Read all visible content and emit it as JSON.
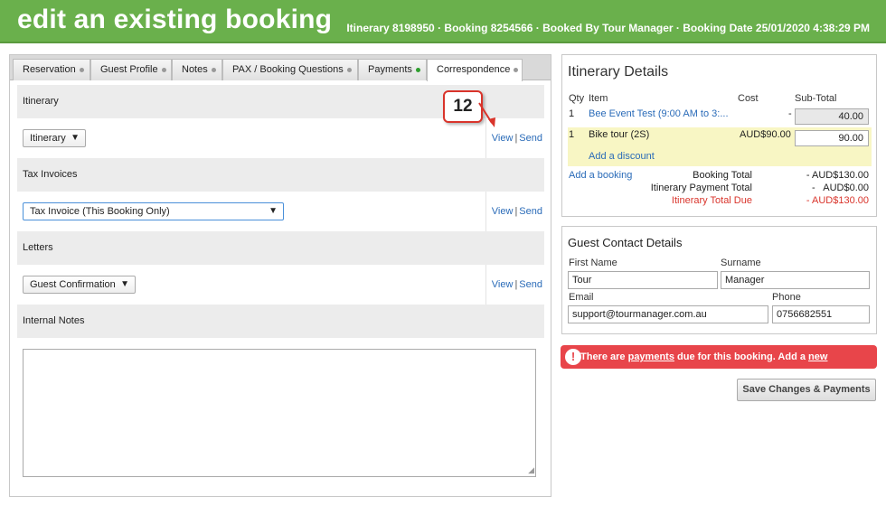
{
  "header": {
    "title": "edit an existing booking",
    "meta": "Itinerary 8198950 · Booking 8254566 · Booked By Tour Manager · Booking Date 25/01/2020 4:38:29 PM"
  },
  "tabs": [
    {
      "label": "Reservation",
      "status": "grey"
    },
    {
      "label": "Guest Profile",
      "status": "grey"
    },
    {
      "label": "Notes",
      "status": "grey"
    },
    {
      "label": "PAX / Booking Questions",
      "status": "grey"
    },
    {
      "label": "Payments",
      "status": "green"
    },
    {
      "label": "Correspondence",
      "status": "grey"
    }
  ],
  "correspondence": {
    "itinerary": {
      "heading": "Itinerary",
      "select": "Itinerary",
      "view": "View",
      "send": "Send"
    },
    "tax_invoices": {
      "heading": "Tax Invoices",
      "select": "Tax Invoice (This Booking Only)",
      "view": "View",
      "send": "Send"
    },
    "letters": {
      "heading": "Letters",
      "select": "Guest Confirmation",
      "view": "View",
      "send": "Send"
    },
    "internal_notes": {
      "heading": "Internal Notes",
      "value": ""
    },
    "sep": "|"
  },
  "callout": "12",
  "itinerary_details": {
    "title": "Itinerary Details",
    "columns": {
      "qty": "Qty",
      "item": "Item",
      "cost": "Cost",
      "subtotal": "Sub-Total"
    },
    "rows": [
      {
        "qty": "1",
        "item": "Bee Event Test (9:00 AM to 3:...",
        "cost": "-",
        "subtotal": "40.00"
      },
      {
        "qty": "1",
        "item": "Bike tour (2S)",
        "cost": "AUD$90.00",
        "subtotal": "90.00"
      }
    ],
    "add_discount": "Add a discount",
    "add_booking": "Add a booking",
    "booking_total_label": "Booking Total",
    "booking_total": "- AUD$130.00",
    "payment_total_label": "Itinerary Payment Total",
    "payment_total": "-   AUD$0.00",
    "total_due_label": "Itinerary Total Due",
    "total_due": "- AUD$130.00"
  },
  "guest_contact": {
    "title": "Guest Contact Details",
    "first_name_label": "First Name",
    "first_name": "Tour",
    "surname_label": "Surname",
    "surname": "Manager",
    "email_label": "Email",
    "email": "support@tourmanager.com.au",
    "phone_label": "Phone",
    "phone": "0756682551"
  },
  "alert": {
    "icon": "!",
    "prefix": "There are ",
    "payments_link": "payments",
    "middle": " due for this booking. Add a ",
    "new_payment_link": "new payment",
    "suffix": "?"
  },
  "save_button": "Save Changes & Payments",
  "colors": {
    "header": "#6ab04c",
    "alert": "#e8454a",
    "link": "#2a6bb8",
    "highlight_row": "#f8f6c4"
  }
}
